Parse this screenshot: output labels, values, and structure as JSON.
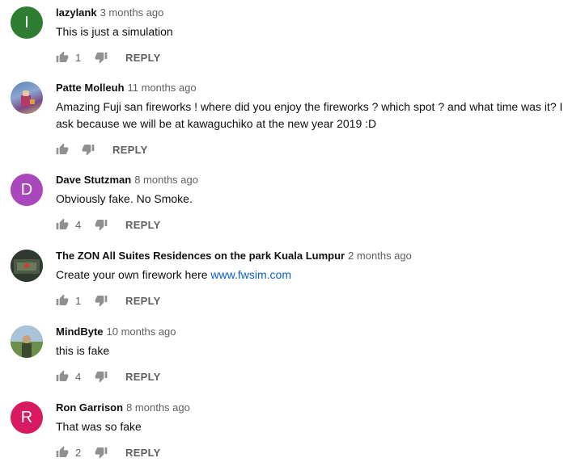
{
  "comments": [
    {
      "author": "lazylank",
      "time": "3 months ago",
      "text": "This is just a simulation",
      "likes": "1",
      "avatar_letter": "I",
      "avatar_color": "#2e7d32",
      "reply_label": "REPLY"
    },
    {
      "author": "Patte Molleuh",
      "time": "11 months ago",
      "text": "Amazing Fuji san  fireworks ! where did you enjoy the fireworks ? which spot ? and what time was it? I ask because we will be at kawaguchiko at the new year 2019 :D",
      "likes": "",
      "avatar_letter": "",
      "avatar_color": "#5b7fb6",
      "reply_label": "REPLY"
    },
    {
      "author": "Dave Stutzman",
      "time": "8 months ago",
      "text": "Obviously fake. No Smoke.",
      "likes": "4",
      "avatar_letter": "D",
      "avatar_color": "#ab47bc",
      "reply_label": "REPLY"
    },
    {
      "author": "The ZON All Suites Residences on the park Kuala Lumpur",
      "time": "2 months ago",
      "text_prefix": "Create your own firework here ",
      "link_text": "www.fwsim.com",
      "likes": "1",
      "avatar_letter": "",
      "avatar_color": "#3d4a3b",
      "reply_label": "REPLY"
    },
    {
      "author": "MindByte",
      "time": "10 months ago",
      "text": "this is fake",
      "likes": "4",
      "avatar_letter": "",
      "avatar_color": "#6e8f4a",
      "reply_label": "REPLY"
    },
    {
      "author": "Ron Garrison",
      "time": "8 months ago",
      "text": "That was so fake",
      "likes": "2",
      "avatar_letter": "R",
      "avatar_color": "#d81b60",
      "reply_label": "REPLY"
    }
  ]
}
